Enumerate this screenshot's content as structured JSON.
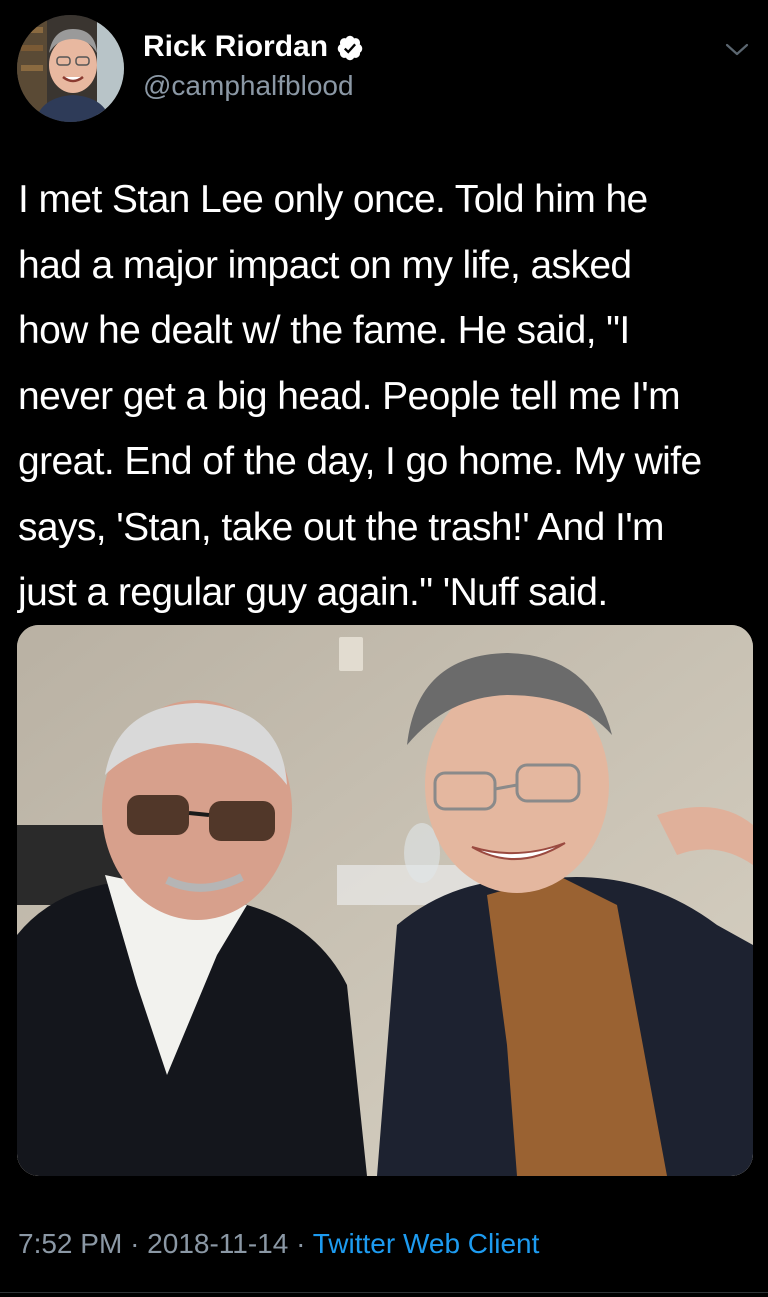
{
  "author": {
    "name": "Rick Riordan",
    "handle": "@camphalfblood",
    "verified": true,
    "avatar_icon": "author-avatar"
  },
  "tweet": {
    "text": "I met Stan Lee only once. Told him he\nhad a major impact on my life, asked\nhow he dealt w/ the fame. He said, \"I\nnever get a big head.  People tell me I'm\ngreat. End of the day, I go home. My wife\nsays, 'Stan, take out the trash!' And I'm\njust a regular guy again.\" 'Nuff said.",
    "photo_icon": "photo"
  },
  "footer": {
    "time": "7:52 PM",
    "separator": "·",
    "date": "2018-11-14",
    "source": "Twitter Web Client"
  },
  "colors": {
    "background": "#000000",
    "text": "#ffffff",
    "secondary": "#8b98a5",
    "link": "#1d9bf0",
    "verified": "#ffffff"
  },
  "icons": {
    "verified": "verified-badge-icon",
    "more": "chevron-down-icon"
  }
}
